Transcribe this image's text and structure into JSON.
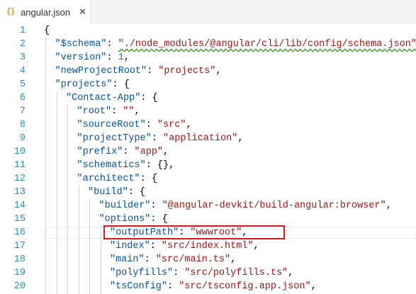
{
  "tab": {
    "icon_text": "{}",
    "filename": "angular.json",
    "close_glyph": "✕"
  },
  "lines": [
    {
      "num": "1",
      "parts": [
        {
          "t": "pun",
          "v": "{"
        }
      ]
    },
    {
      "num": "2",
      "parts": [
        {
          "t": "key",
          "v": "\"$schema\""
        },
        {
          "t": "pun",
          "v": ": "
        },
        {
          "t": "str",
          "v": "\"./node_modules/@angular/cli/lib/config/schema.json\"",
          "squiggle": true
        },
        {
          "t": "pun",
          "v": ","
        }
      ]
    },
    {
      "num": "3",
      "parts": [
        {
          "t": "key",
          "v": "\"version\""
        },
        {
          "t": "pun",
          "v": ": "
        },
        {
          "t": "num",
          "v": "1"
        },
        {
          "t": "pun",
          "v": ","
        }
      ]
    },
    {
      "num": "4",
      "parts": [
        {
          "t": "key",
          "v": "\"newProjectRoot\""
        },
        {
          "t": "pun",
          "v": ": "
        },
        {
          "t": "str",
          "v": "\"projects\""
        },
        {
          "t": "pun",
          "v": ","
        }
      ]
    },
    {
      "num": "5",
      "parts": [
        {
          "t": "key",
          "v": "\"projects\""
        },
        {
          "t": "pun",
          "v": ": {"
        }
      ]
    },
    {
      "num": "6",
      "parts": [
        {
          "t": "key",
          "v": "\"Contact-App\""
        },
        {
          "t": "pun",
          "v": ": {"
        }
      ]
    },
    {
      "num": "7",
      "parts": [
        {
          "t": "key",
          "v": "\"root\""
        },
        {
          "t": "pun",
          "v": ": "
        },
        {
          "t": "str",
          "v": "\"\""
        },
        {
          "t": "pun",
          "v": ","
        }
      ]
    },
    {
      "num": "8",
      "parts": [
        {
          "t": "key",
          "v": "\"sourceRoot\""
        },
        {
          "t": "pun",
          "v": ": "
        },
        {
          "t": "str",
          "v": "\"src\""
        },
        {
          "t": "pun",
          "v": ","
        }
      ]
    },
    {
      "num": "9",
      "parts": [
        {
          "t": "key",
          "v": "\"projectType\""
        },
        {
          "t": "pun",
          "v": ": "
        },
        {
          "t": "str",
          "v": "\"application\""
        },
        {
          "t": "pun",
          "v": ","
        }
      ]
    },
    {
      "num": "10",
      "parts": [
        {
          "t": "key",
          "v": "\"prefix\""
        },
        {
          "t": "pun",
          "v": ": "
        },
        {
          "t": "str",
          "v": "\"app\""
        },
        {
          "t": "pun",
          "v": ","
        }
      ]
    },
    {
      "num": "11",
      "parts": [
        {
          "t": "key",
          "v": "\"schematics\""
        },
        {
          "t": "pun",
          "v": ": {},"
        }
      ]
    },
    {
      "num": "12",
      "parts": [
        {
          "t": "key",
          "v": "\"architect\""
        },
        {
          "t": "pun",
          "v": ": {"
        }
      ]
    },
    {
      "num": "13",
      "parts": [
        {
          "t": "key",
          "v": "\"build\""
        },
        {
          "t": "pun",
          "v": ": {"
        }
      ]
    },
    {
      "num": "14",
      "parts": [
        {
          "t": "key",
          "v": "\"builder\""
        },
        {
          "t": "pun",
          "v": ": "
        },
        {
          "t": "str",
          "v": "\"@angular-devkit/build-angular:browser\""
        },
        {
          "t": "pun",
          "v": ","
        }
      ]
    },
    {
      "num": "15",
      "parts": [
        {
          "t": "key",
          "v": "\"options\""
        },
        {
          "t": "pun",
          "v": ": {"
        }
      ]
    },
    {
      "num": "16",
      "parts": [
        {
          "t": "key",
          "v": "\"outputPath\""
        },
        {
          "t": "pun",
          "v": ": "
        },
        {
          "t": "str",
          "v": "\"wwwroot\""
        },
        {
          "t": "pun",
          "v": ","
        }
      ]
    },
    {
      "num": "17",
      "parts": [
        {
          "t": "key",
          "v": "\"index\""
        },
        {
          "t": "pun",
          "v": ": "
        },
        {
          "t": "str",
          "v": "\"src/index.html\""
        },
        {
          "t": "pun",
          "v": ","
        }
      ]
    },
    {
      "num": "18",
      "parts": [
        {
          "t": "key",
          "v": "\"main\""
        },
        {
          "t": "pun",
          "v": ": "
        },
        {
          "t": "str",
          "v": "\"src/main.ts\""
        },
        {
          "t": "pun",
          "v": ","
        }
      ]
    },
    {
      "num": "19",
      "parts": [
        {
          "t": "key",
          "v": "\"polyfills\""
        },
        {
          "t": "pun",
          "v": ": "
        },
        {
          "t": "str",
          "v": "\"src/polyfills.ts\""
        },
        {
          "t": "pun",
          "v": ","
        }
      ]
    },
    {
      "num": "20",
      "parts": [
        {
          "t": "key",
          "v": "\"tsConfig\""
        },
        {
          "t": "pun",
          "v": ": "
        },
        {
          "t": "str",
          "v": "\"src/tsconfig.app.json\""
        },
        {
          "t": "pun",
          "v": ","
        }
      ]
    }
  ],
  "highlighted_line": "16",
  "colors": {
    "key": "#0451a5",
    "string": "#a31515",
    "number": "#098658",
    "line_number": "#2b91af",
    "highlight_box": "#d9171f"
  }
}
